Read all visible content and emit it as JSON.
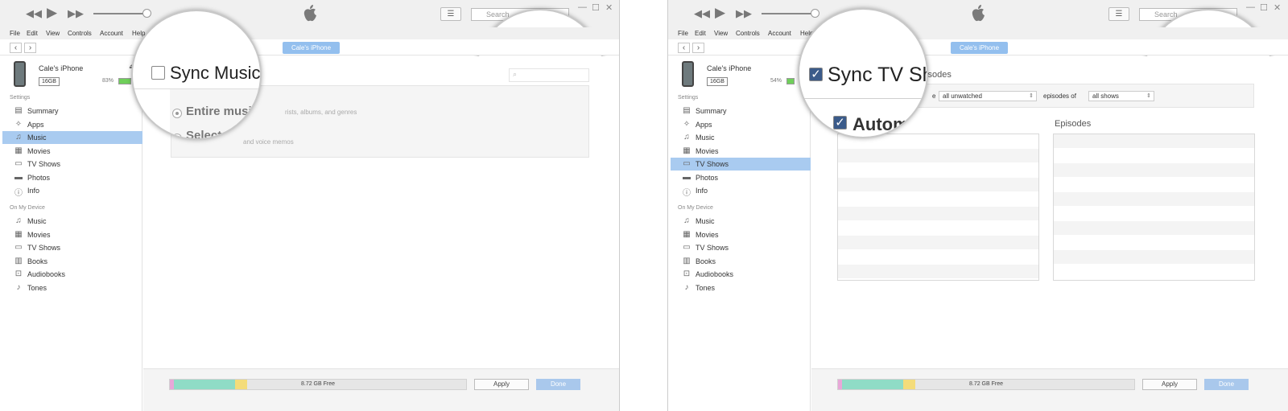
{
  "menu": [
    "File",
    "Edit",
    "View",
    "Controls",
    "Account",
    "Help"
  ],
  "search_placeholder": "Search",
  "device": {
    "name": "Cale's iPhone",
    "capacity": "16GB"
  },
  "sidebar_settings_header": "Settings",
  "sidebar_device_header": "On My Device",
  "settings_items": [
    {
      "label": "Summary",
      "icon": "summary-icon"
    },
    {
      "label": "Apps",
      "icon": "apps-icon"
    },
    {
      "label": "Music",
      "icon": "music-icon"
    },
    {
      "label": "Movies",
      "icon": "movies-icon"
    },
    {
      "label": "TV Shows",
      "icon": "tv-shows-icon"
    },
    {
      "label": "Photos",
      "icon": "photos-icon"
    },
    {
      "label": "Info",
      "icon": "info-icon"
    }
  ],
  "device_items": [
    {
      "label": "Music",
      "icon": "music-icon"
    },
    {
      "label": "Movies",
      "icon": "movies-icon"
    },
    {
      "label": "TV Shows",
      "icon": "tv-shows-icon"
    },
    {
      "label": "Books",
      "icon": "books-icon"
    },
    {
      "label": "Audiobooks",
      "icon": "audiobooks-icon"
    },
    {
      "label": "Tones",
      "icon": "tones-icon"
    }
  ],
  "storage_free": "8.72 GB Free",
  "apply_label": "Apply",
  "done_label": "Done",
  "colors": {
    "accent": "#a9cbf0",
    "pill": "#93bfee",
    "checkbox": "#3b5b8a"
  },
  "left": {
    "battery_pct": "83%",
    "selected_item": "Music",
    "sync_label": "Sync Music",
    "option_entire": "Entire music",
    "option_entire_rest": "rists, albums, and genres",
    "option_selected": "Selected",
    "option_selected_rest": "and voice memos"
  },
  "right": {
    "battery_pct": "54%",
    "selected_item": "TV Shows",
    "sync_label": "Sync TV Sh",
    "episodes_header_fragment": "pisodes",
    "auto_label": "Autom",
    "include_fragment": "e",
    "include_value": "all unwatched",
    "episodes_of_label": "episodes of",
    "shows_value": "all shows",
    "episodes_col_label": "Episodes"
  }
}
